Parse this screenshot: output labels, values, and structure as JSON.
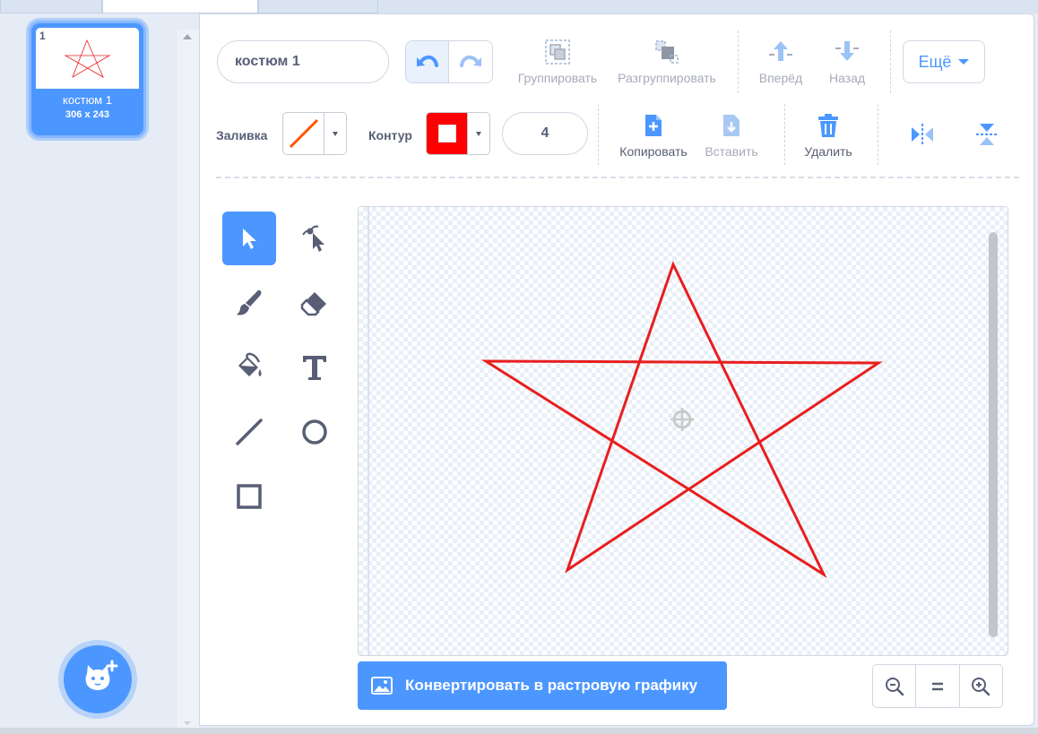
{
  "costume_list": {
    "items": [
      {
        "index": "1",
        "name": "костюм 1",
        "size": "306 x 243",
        "selected": true
      }
    ],
    "add_costume_icon": "cat-plus-icon"
  },
  "toolbar": {
    "costume_name": "костюм 1",
    "undo_icon": "undo-icon",
    "redo_icon": "redo-icon",
    "group_label": "Группировать",
    "ungroup_label": "Разгруппировать",
    "forward_label": "Вперёд",
    "backward_label": "Назад",
    "more_label": "Ещё",
    "fill_label": "Заливка",
    "outline_label": "Контур",
    "outline_color": "#ff0000",
    "stroke_width": "4",
    "copy_label": "Копировать",
    "paste_label": "Вставить",
    "delete_label": "Удалить"
  },
  "tools": [
    {
      "name": "select-tool",
      "active": true
    },
    {
      "name": "reshape-tool",
      "active": false
    },
    {
      "name": "brush-tool",
      "active": false
    },
    {
      "name": "eraser-tool",
      "active": false
    },
    {
      "name": "fill-tool",
      "active": false
    },
    {
      "name": "text-tool",
      "active": false
    },
    {
      "name": "line-tool",
      "active": false
    },
    {
      "name": "circle-tool",
      "active": false
    },
    {
      "name": "rectangle-tool",
      "active": false
    }
  ],
  "canvas": {
    "shape": "star",
    "stroke_color": "#e81e1e"
  },
  "footer": {
    "convert_label": "Конвертировать в растровую графику"
  },
  "colors": {
    "accent": "#4c97ff",
    "text": "#575e75",
    "disabled": "#a6abb8"
  }
}
